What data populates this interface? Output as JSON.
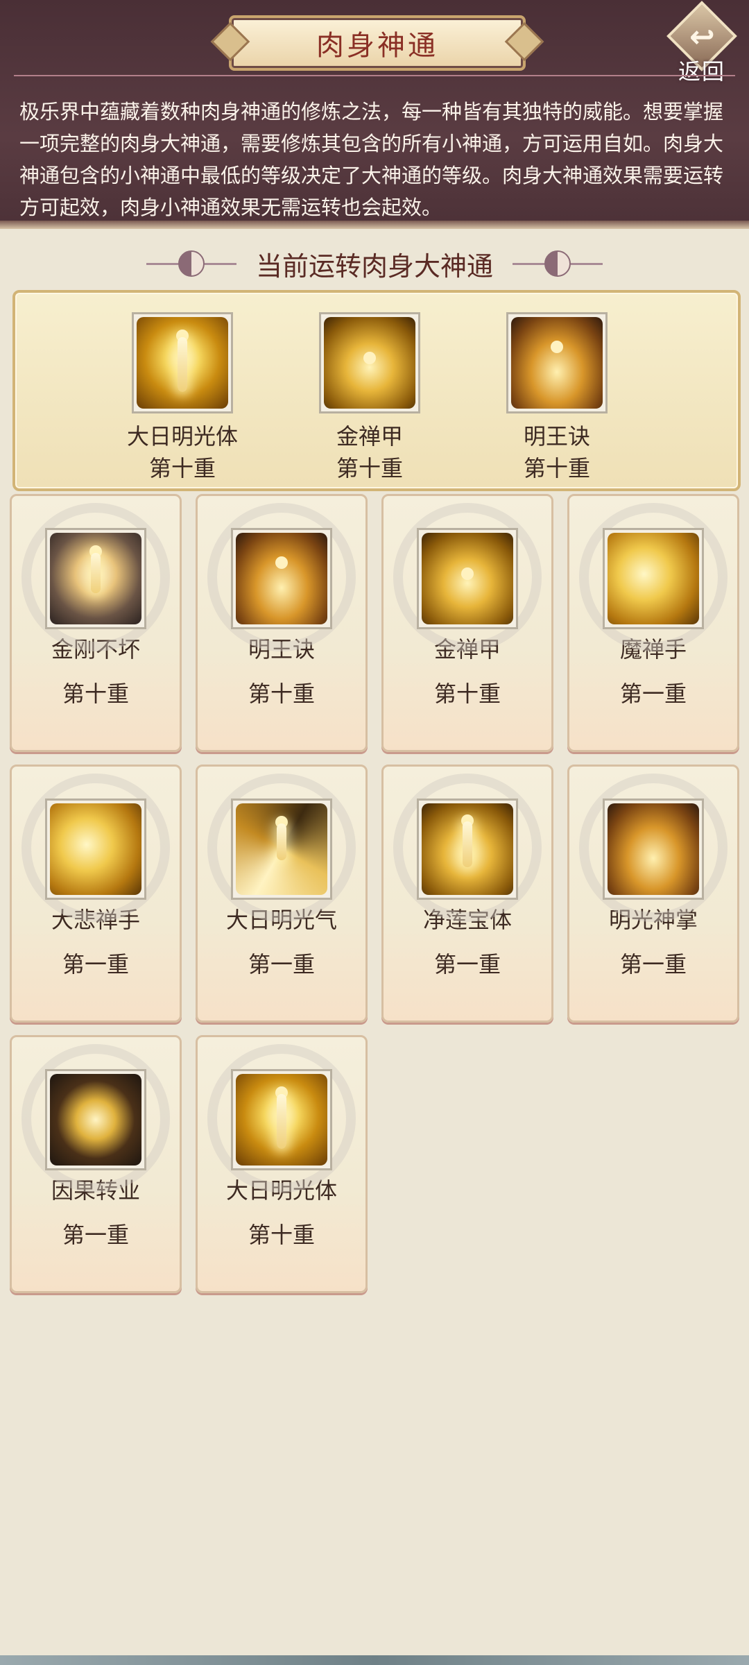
{
  "header": {
    "title": "肉身神通",
    "back_label": "返回",
    "description": "极乐界中蕴藏着数种肉身神通的修炼之法，每一种皆有其独特的威能。想要掌握一项完整的肉身大神通，需要修炼其包含的所有小神通，方可运用自如。肉身大神通包含的小神通中最低的等级决定了大神通的等级。肉身大神通效果需要运转方可起效，肉身小神通效果无需运转也会起效。"
  },
  "active": {
    "title": "当前运转肉身大神通",
    "items": [
      {
        "name": "大日明光体",
        "level": "第十重",
        "icon": "radiant-body-icon"
      },
      {
        "name": "金禅甲",
        "level": "第十重",
        "icon": "lotus-buddha-icon"
      },
      {
        "name": "明王诀",
        "level": "第十重",
        "icon": "meditating-flame-icon"
      }
    ]
  },
  "skills": [
    {
      "name": "金刚不坏",
      "level": "第十重",
      "icon": "glowing-orb-figure-icon"
    },
    {
      "name": "明王诀",
      "level": "第十重",
      "icon": "meditating-flame-icon"
    },
    {
      "name": "金禅甲",
      "level": "第十重",
      "icon": "lotus-buddha-icon"
    },
    {
      "name": "魔禅手",
      "level": "第一重",
      "icon": "mudra-hand-icon"
    },
    {
      "name": "大悲禅手",
      "level": "第一重",
      "icon": "open-palm-icon"
    },
    {
      "name": "大日明光气",
      "level": "第一重",
      "icon": "swirl-figure-icon"
    },
    {
      "name": "净莲宝体",
      "level": "第一重",
      "icon": "lotus-body-icon"
    },
    {
      "name": "明光神掌",
      "level": "第一重",
      "icon": "fire-palm-icon"
    },
    {
      "name": "因果转业",
      "level": "第一重",
      "icon": "karma-wheel-icon"
    },
    {
      "name": "大日明光体",
      "level": "第十重",
      "icon": "radiant-body-icon"
    }
  ]
}
